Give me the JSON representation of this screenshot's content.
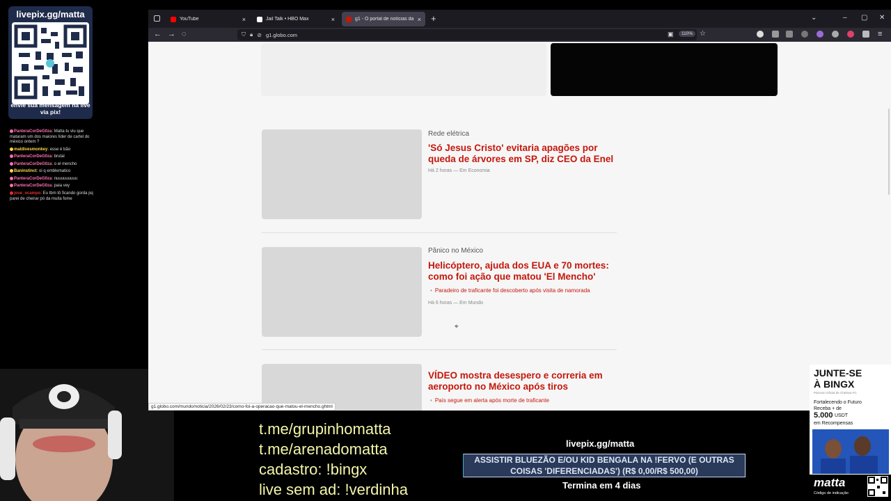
{
  "browser": {
    "tabs": [
      {
        "label": "YouTube",
        "color": "#ff0000",
        "active": false
      },
      {
        "label": "Jail Talk • HBO Max",
        "color": "#ffffff",
        "active": false
      },
      {
        "label": "g1 - O portal de notícias da Gl",
        "color": "#c4170c",
        "active": true
      }
    ],
    "url": "g1.globo.com",
    "zoom": "110%",
    "status_url": "g1.globo.com/mundo/noticia/2026/02/23/como-foi-a-operacao-que-matou-el-mencho.ghtml"
  },
  "page": {
    "articles": [
      {
        "kicker": "Rede elétrica",
        "headline": "'Só Jesus Cristo' evitaria apagões por queda de árvores em SP, diz CEO da Enel",
        "meta": "Há 2 horas — Em Economia",
        "related": ""
      },
      {
        "kicker": "Pânico no México",
        "headline": "Helicóptero, ajuda dos EUA e 70 mortes: como foi ação que matou 'El Mencho'",
        "meta": "Há 6 horas — Em Mundo",
        "related": "Paradeiro de traficante foi descoberto após visita de namorada"
      },
      {
        "kicker": "",
        "headline": "VÍDEO mostra desespero e correria em aeroporto no México após tiros",
        "meta": "",
        "related": "País segue em alerta após morte de traficante"
      }
    ]
  },
  "overlay": {
    "qr_title": "livepix.gg/matta",
    "qr_caption": "envie sua mensagem na live via pix!",
    "chat": [
      {
        "user": "PanteraCorDeG0za",
        "user_color": "#ff6fb0",
        "message": "Matta tu viu que mataram um dos maiores líder de cartel do méxico ontem ?"
      },
      {
        "user": "maldivesmonkey",
        "user_color": "#ffd84a",
        "message": "esse é bão"
      },
      {
        "user": "PanteraCorDeG0za",
        "user_color": "#ff6fb0",
        "message": "brutal"
      },
      {
        "user": "PanteraCorDeG0za",
        "user_color": "#ff6fb0",
        "message": "o el mencho"
      },
      {
        "user": "Baninstinct",
        "user_color": "#ffd84a",
        "message": "oi q emblematico"
      },
      {
        "user": "PanteraCorDeG0za",
        "user_color": "#ff6fb0",
        "message": "nuuuuuuuuu"
      },
      {
        "user": "PanteraCorDeG0za",
        "user_color": "#ff6fb0",
        "message": "paia vey"
      },
      {
        "user": "jose_ocampo",
        "user_color": "#e03030",
        "message": "Eu tbm tô ficando gorda pq parei de cheirar pó da muita fome"
      }
    ],
    "links": [
      "t.me/grupinhomatta",
      "t.me/arenadomatta",
      "cadastro: !bingx",
      "live sem ad: !verdinha"
    ],
    "goal_title": "livepix.gg/matta",
    "goal_text": "ASSISTIR BLUEZÃO E/OU KID BENGALA NA !FERVO (E OUTRAS COISAS 'DIFERENCIADAS') (R$ 0,00/R$ 500,00)",
    "goal_progress": 0,
    "goal_ends": "Termina em 4 dias"
  },
  "ad": {
    "title_line1": "JUNTE-SE",
    "title_line2": "À BINGX",
    "small": "Parceiro Oficial de Chelsea FC",
    "line1": "Fortalecendo o Futuro",
    "line2": "Receba + de",
    "amount": "5.000",
    "usdt": "USDT",
    "line3": "em Recompensas",
    "brand": "matta",
    "code": "Código de indicação"
  }
}
